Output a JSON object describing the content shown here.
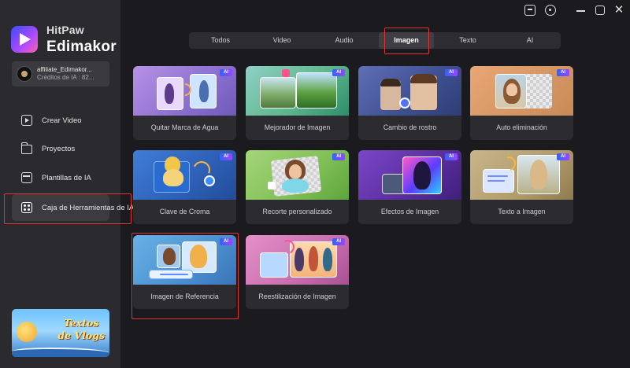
{
  "app": {
    "brand_top": "HitPaw",
    "brand_main": "Edimakor"
  },
  "account": {
    "name": "affiliate_Edimakor...",
    "credits": "Créditos de IA : 82..."
  },
  "sidebar": {
    "items": [
      {
        "label": "Crear Video",
        "icon": "video-icon"
      },
      {
        "label": "Proyectos",
        "icon": "folder-icon"
      },
      {
        "label": "Plantillas de IA",
        "icon": "templates-icon"
      },
      {
        "label": "Caja de Herramientas de IA",
        "icon": "toolbox-icon",
        "active": true
      }
    ]
  },
  "promo": {
    "line1": "Textos",
    "line2": "de Vlogs"
  },
  "tabs": [
    {
      "label": "Todos"
    },
    {
      "label": "Video"
    },
    {
      "label": "Audio"
    },
    {
      "label": "Imagen",
      "active": true
    },
    {
      "label": "Texto"
    },
    {
      "label": "AI"
    }
  ],
  "badge": "AI",
  "tools": [
    {
      "label": "Quitar Marca de Agua"
    },
    {
      "label": "Mejorador de Imagen"
    },
    {
      "label": "Cambio de rostro"
    },
    {
      "label": "Auto eliminación"
    },
    {
      "label": "Clave de Croma"
    },
    {
      "label": "Recorte personalizado"
    },
    {
      "label": "Efectos de Imagen"
    },
    {
      "label": "Texto a Imagen"
    },
    {
      "label": "Imagen de Referencia"
    },
    {
      "label": "Reestilización de Imagen"
    }
  ],
  "colors": {
    "accent_ai": "#6a4dff",
    "highlight_box": "#e03535",
    "background": "#1b1b1f",
    "sidebar": "#2b2b2f"
  }
}
